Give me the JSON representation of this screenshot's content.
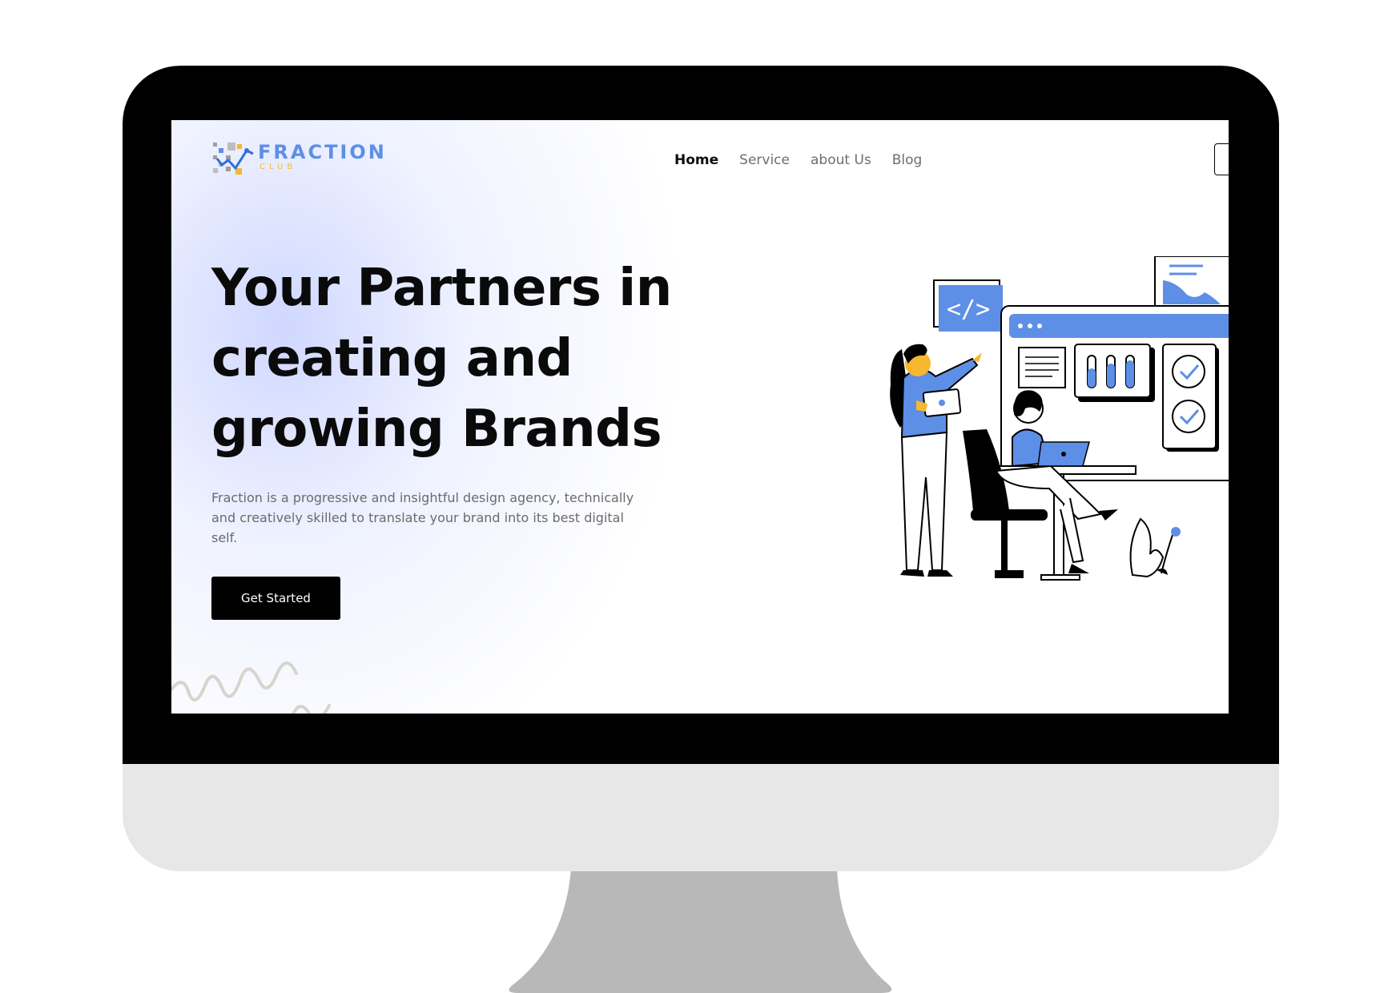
{
  "brand": {
    "name": "FRACTION",
    "sub": "CLUB",
    "colors": {
      "primary": "#5d8fe6",
      "accent": "#f5b82e",
      "dark": "#000000"
    }
  },
  "nav": {
    "items": [
      {
        "label": "Home",
        "active": true
      },
      {
        "label": "Service",
        "active": false
      },
      {
        "label": "about Us",
        "active": false
      },
      {
        "label": "Blog",
        "active": false
      }
    ]
  },
  "hero": {
    "title": "Your Partners in creating and growing Brands",
    "description": "Fraction is a progressive and insightful design agency, technically and creatively skilled to translate your brand into its best digital self.",
    "cta_label": "Get Started"
  },
  "icons": {
    "logo": "fraction-logo-icon",
    "code": "code-icon",
    "checkmark": "checkmark-icon",
    "illustration": "team-working-illustration"
  }
}
